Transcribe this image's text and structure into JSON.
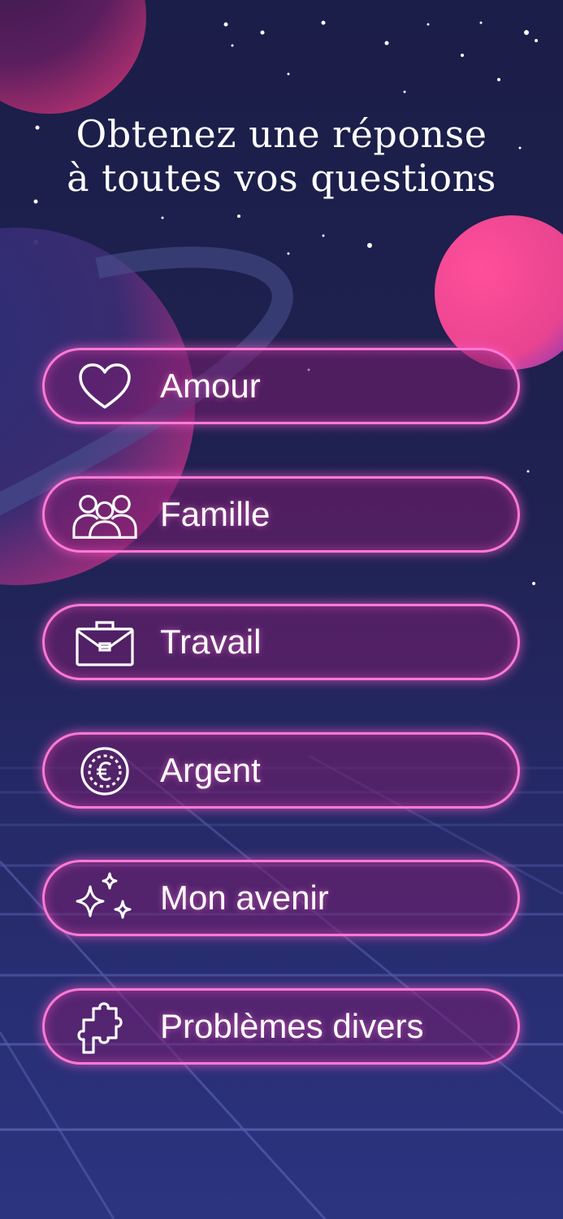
{
  "title": {
    "line1": "Obtenez une réponse",
    "line2": "à toutes vos questions"
  },
  "colors": {
    "accent": "#ff7ad4",
    "planet_pink": "#e8448f",
    "background": "#1f2150"
  },
  "categories": [
    {
      "label": "Amour",
      "icon": "heart-icon"
    },
    {
      "label": "Famille",
      "icon": "family-icon"
    },
    {
      "label": "Travail",
      "icon": "briefcase-icon"
    },
    {
      "label": "Argent",
      "icon": "euro-coin-icon"
    },
    {
      "label": "Mon avenir",
      "icon": "sparkles-icon"
    },
    {
      "label": "Problèmes divers",
      "icon": "puzzle-icon"
    }
  ]
}
